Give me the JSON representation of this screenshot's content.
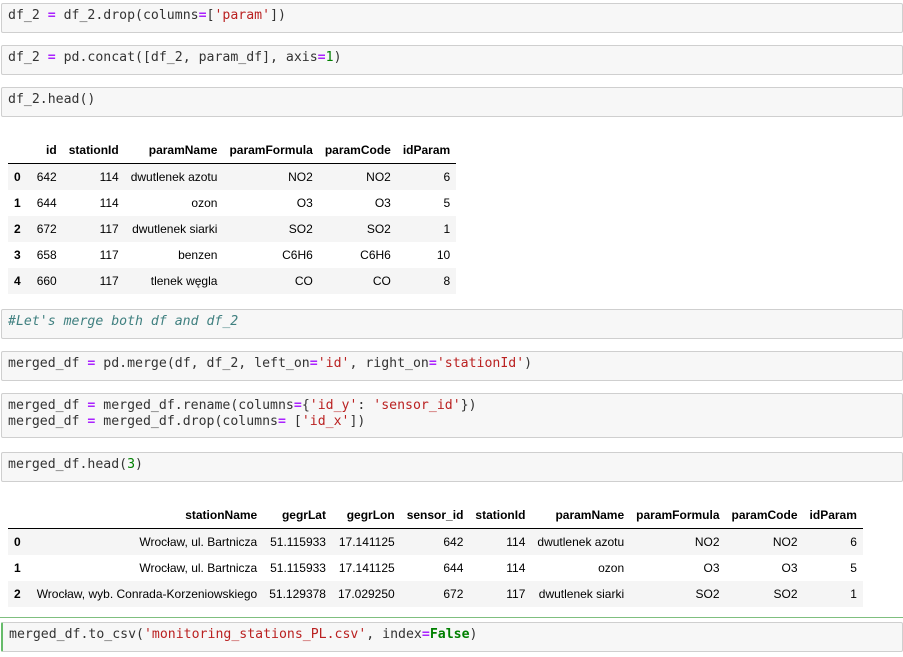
{
  "cells": [
    {
      "id": "c1",
      "tokens": [
        [
          "",
          "df_2 "
        ],
        [
          "op",
          "="
        ],
        [
          "",
          " df_2.drop(columns"
        ],
        [
          "op",
          "="
        ],
        [
          "",
          "["
        ],
        [
          "str",
          "'param'"
        ],
        [
          "",
          "])"
        ]
      ]
    },
    {
      "id": "c2",
      "tokens": [
        [
          "",
          "df_2 "
        ],
        [
          "op",
          "="
        ],
        [
          "",
          " pd.concat([df_2, param_df], axis"
        ],
        [
          "op",
          "="
        ],
        [
          "num",
          "1"
        ],
        [
          "",
          ")"
        ]
      ]
    },
    {
      "id": "c3",
      "tokens": [
        [
          "",
          "df_2.head()"
        ]
      ]
    },
    {
      "id": "c4",
      "tokens": [
        [
          "md",
          "#Let's merge both df and df_2"
        ]
      ]
    },
    {
      "id": "c5",
      "tokens": [
        [
          "",
          "merged_df "
        ],
        [
          "op",
          "="
        ],
        [
          "",
          " pd.merge(df, df_2, left_on"
        ],
        [
          "op",
          "="
        ],
        [
          "str",
          "'id'"
        ],
        [
          "",
          ", right_on"
        ],
        [
          "op",
          "="
        ],
        [
          "str",
          "'stationId'"
        ],
        [
          "",
          ")"
        ]
      ]
    },
    {
      "id": "c6a",
      "tokens": [
        [
          "",
          "merged_df "
        ],
        [
          "op",
          "="
        ],
        [
          "",
          " merged_df.rename(columns"
        ],
        [
          "op",
          "="
        ],
        [
          "",
          "{"
        ],
        [
          "str",
          "'id_y'"
        ],
        [
          "",
          ": "
        ],
        [
          "str",
          "'sensor_id'"
        ],
        [
          "",
          "})"
        ]
      ]
    },
    {
      "id": "c6b",
      "tokens": [
        [
          "",
          "merged_df "
        ],
        [
          "op",
          "="
        ],
        [
          "",
          " merged_df.drop(columns"
        ],
        [
          "op",
          "="
        ],
        [
          "",
          " ["
        ],
        [
          "str",
          "'id_x'"
        ],
        [
          "",
          "])"
        ]
      ]
    },
    {
      "id": "c7",
      "tokens": [
        [
          "",
          "merged_df.head("
        ],
        [
          "num",
          "3"
        ],
        [
          "",
          ")"
        ]
      ]
    },
    {
      "id": "c8",
      "tokens": [
        [
          "",
          "merged_df.to_csv("
        ],
        [
          "str",
          "'monitoring_stations_PL.csv'"
        ],
        [
          "",
          ", index"
        ],
        [
          "op",
          "="
        ],
        [
          "kw",
          "False"
        ],
        [
          "",
          ")"
        ]
      ]
    }
  ],
  "table1": {
    "columns": [
      "",
      "id",
      "stationId",
      "paramName",
      "paramFormula",
      "paramCode",
      "idParam"
    ],
    "rows": [
      [
        "0",
        "642",
        "114",
        "dwutlenek azotu",
        "NO2",
        "NO2",
        "6"
      ],
      [
        "1",
        "644",
        "114",
        "ozon",
        "O3",
        "O3",
        "5"
      ],
      [
        "2",
        "672",
        "117",
        "dwutlenek siarki",
        "SO2",
        "SO2",
        "1"
      ],
      [
        "3",
        "658",
        "117",
        "benzen",
        "C6H6",
        "C6H6",
        "10"
      ],
      [
        "4",
        "660",
        "117",
        "tlenek węgla",
        "CO",
        "CO",
        "8"
      ]
    ]
  },
  "table2": {
    "columns": [
      "",
      "stationName",
      "gegrLat",
      "gegrLon",
      "sensor_id",
      "stationId",
      "paramName",
      "paramFormula",
      "paramCode",
      "idParam"
    ],
    "rows": [
      [
        "0",
        "Wrocław, ul. Bartnicza",
        "51.115933",
        "17.141125",
        "642",
        "114",
        "dwutlenek azotu",
        "NO2",
        "NO2",
        "6"
      ],
      [
        "1",
        "Wrocław, ul. Bartnicza",
        "51.115933",
        "17.141125",
        "644",
        "114",
        "ozon",
        "O3",
        "O3",
        "5"
      ],
      [
        "2",
        "Wrocław, wyb. Conrada-Korzeniowskiego",
        "51.129378",
        "17.029250",
        "672",
        "117",
        "dwutlenek siarki",
        "SO2",
        "SO2",
        "1"
      ]
    ]
  }
}
